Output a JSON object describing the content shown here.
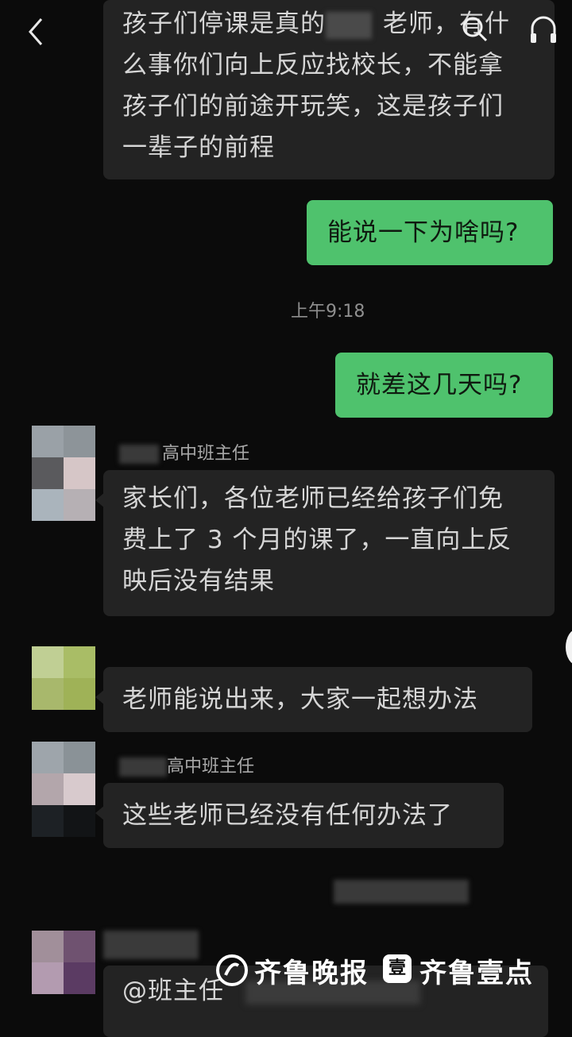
{
  "header": {
    "back_icon": "chevron-left-icon",
    "search_icon": "search-icon",
    "headset_icon": "headset-icon"
  },
  "messages": [
    {
      "side": "left",
      "text_lines": [
        "孩子们停课是真的",
        "老师，有什",
        "么事你们向上反应找校长，不能拿",
        "孩子们的前途开玩笑，这是孩子们",
        "一辈子的前程"
      ]
    },
    {
      "side": "right",
      "text": "能说一下为啥吗?"
    },
    {
      "timestamp": "上午9:18"
    },
    {
      "side": "right",
      "text": "就差这几天吗?"
    },
    {
      "side": "left",
      "sender": "高中班主任",
      "text_lines": [
        "家长们，各位老师已经给孩子们免",
        "费上了 3 个月的课了，一直向上反",
        "映后没有结果"
      ]
    },
    {
      "side": "left",
      "text": "老师能说出来，大家一起想办法"
    },
    {
      "side": "left",
      "sender": "高中班主任",
      "text": "这些老师已经没有任何办法了"
    },
    {
      "side": "left",
      "text": "@班主任"
    }
  ],
  "watermark": {
    "left": "齐鲁晚报",
    "badge": "壹",
    "right": "齐鲁壹点"
  }
}
